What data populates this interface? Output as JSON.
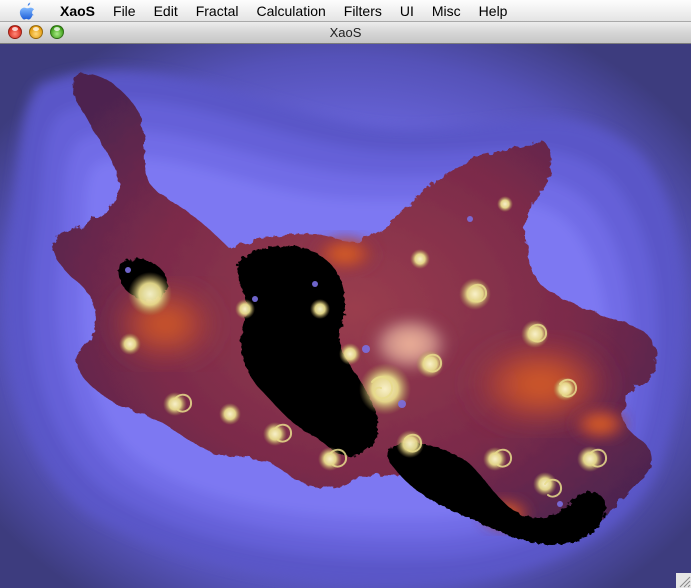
{
  "menubar": {
    "app_name": "XaoS",
    "items": [
      "File",
      "Edit",
      "Fractal",
      "Calculation",
      "Filters",
      "UI",
      "Misc",
      "Help"
    ]
  },
  "window": {
    "title": "XaoS"
  },
  "colors": {
    "background_outer": "#3d3c7e",
    "background_band": "#6a66dd",
    "fractal_body": "#7a2a4a",
    "fractal_core": "#000000",
    "glow_orange": "#e0652a",
    "spiral_gold": "#e8dc8c"
  },
  "icons": {
    "apple": "apple-logo-icon",
    "close": "close-window-icon",
    "minimize": "minimize-window-icon",
    "zoom": "zoom-window-icon",
    "resize": "resize-grip-icon"
  }
}
